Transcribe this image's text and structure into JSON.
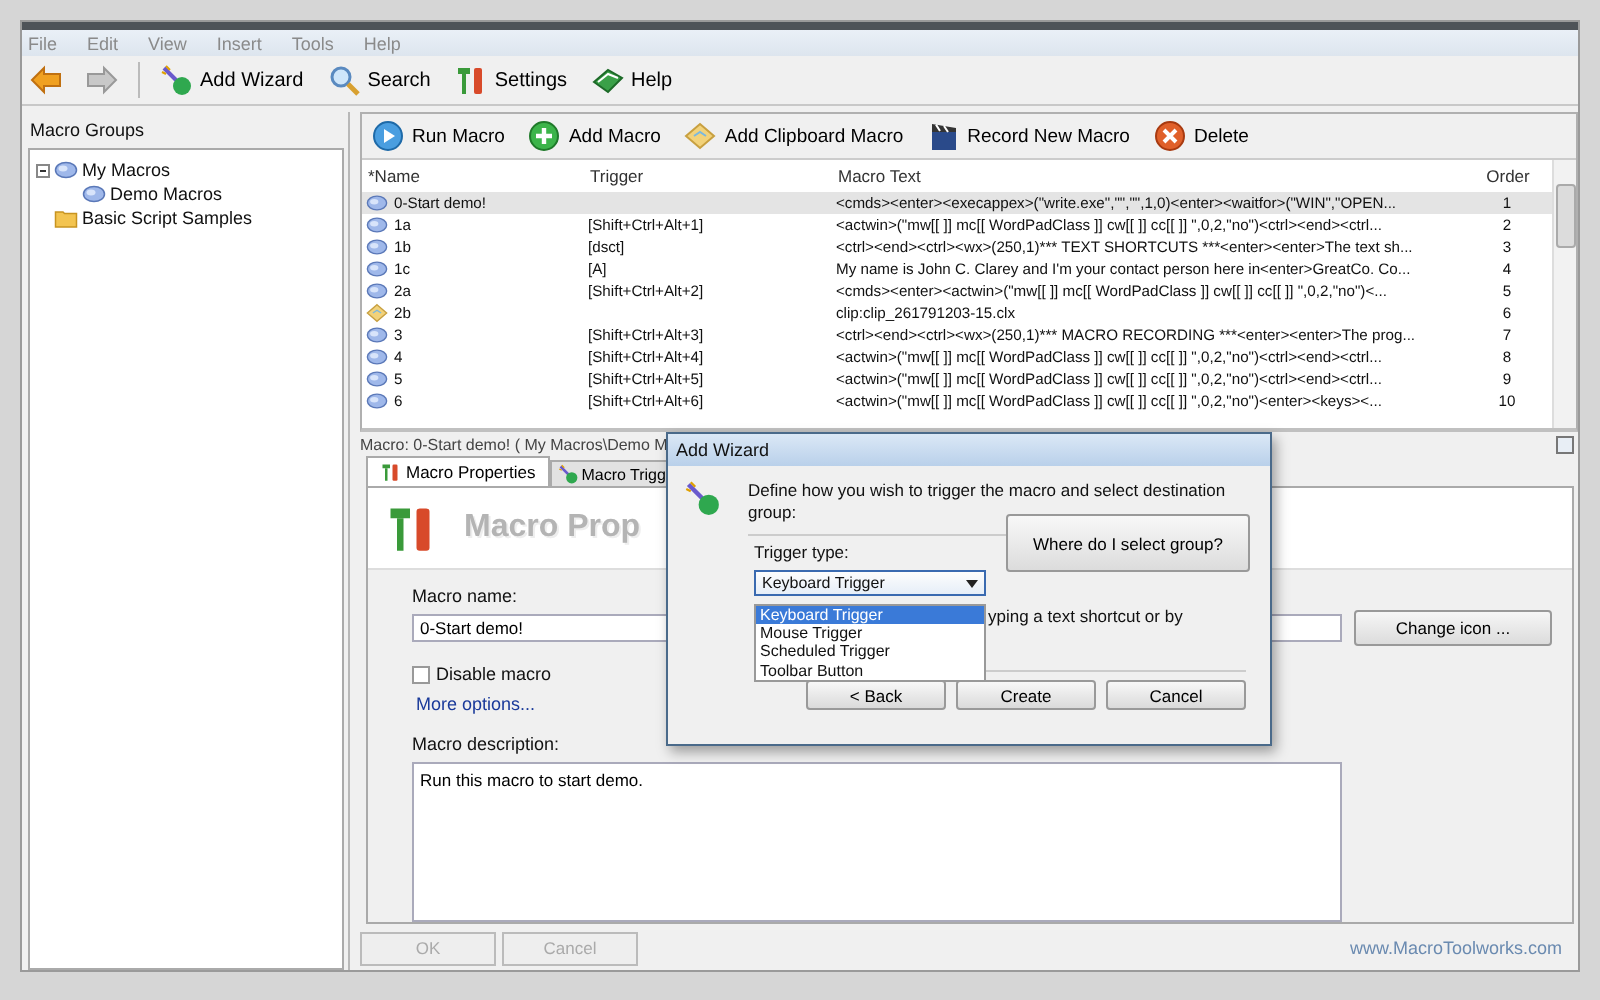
{
  "menu": [
    "File",
    "Edit",
    "View",
    "Insert",
    "Tools",
    "Help"
  ],
  "toolbar": [
    {
      "kind": "wizard",
      "label": "Add Wizard"
    },
    {
      "kind": "search",
      "label": "Search"
    },
    {
      "kind": "settings",
      "label": "Settings"
    },
    {
      "kind": "help",
      "label": "Help"
    }
  ],
  "groups": {
    "title": "Macro Groups",
    "tree": [
      {
        "label": "My Macros",
        "kind": "macro",
        "expanded": true,
        "children": [
          {
            "label": "Demo Macros",
            "kind": "macro"
          }
        ]
      },
      {
        "label": "Basic Script Samples",
        "kind": "folder"
      }
    ]
  },
  "macro_toolbar": [
    {
      "kind": "run",
      "label": "Run Macro"
    },
    {
      "kind": "add",
      "label": "Add Macro"
    },
    {
      "kind": "clip",
      "label": "Add Clipboard Macro"
    },
    {
      "kind": "record",
      "label": "Record New Macro"
    },
    {
      "kind": "delete",
      "label": "Delete"
    }
  ],
  "table": {
    "columns": [
      "*Name",
      "Trigger",
      "Macro Text",
      "Order"
    ],
    "rows": [
      {
        "kind": "macro",
        "selected": true,
        "name": "0-Start demo!",
        "trigger": "",
        "text": "<cmds><enter><execappex>(\"write.exe\",\"\",\"\",1,0)<enter><waitfor>(\"WIN\",\"OPEN...",
        "order": "1"
      },
      {
        "kind": "macro",
        "selected": false,
        "name": "1a",
        "trigger": "[Shift+Ctrl+Alt+1]",
        "text": "<actwin>(\"mw[[  ]] mc[[ WordPadClass ]] cw[[  ]] cc[[  ]] \",0,2,\"no\")<ctrl><end><ctrl...",
        "order": "2"
      },
      {
        "kind": "macro",
        "selected": false,
        "name": "1b",
        "trigger": "[dsct]",
        "text": "<ctrl><end><ctrl><wx>(250,1)*** TEXT SHORTCUTS ***<enter><enter>The text sh...",
        "order": "3"
      },
      {
        "kind": "macro",
        "selected": false,
        "name": "1c",
        "trigger": "[A]",
        "text": "My name is John C. Clarey and I'm your contact person here in<enter>GreatCo. Co...",
        "order": "4"
      },
      {
        "kind": "macro",
        "selected": false,
        "name": "2a",
        "trigger": "[Shift+Ctrl+Alt+2]",
        "text": "<cmds><enter><actwin>(\"mw[[  ]] mc[[ WordPadClass ]] cw[[  ]] cc[[  ]] \",0,2,\"no\")<...",
        "order": "5"
      },
      {
        "kind": "clip",
        "selected": false,
        "name": "2b",
        "trigger": "",
        "text": "clip:clip_261791203-15.clx",
        "order": "6"
      },
      {
        "kind": "macro",
        "selected": false,
        "name": "3",
        "trigger": "[Shift+Ctrl+Alt+3]",
        "text": "<ctrl><end><ctrl><wx>(250,1)*** MACRO RECORDING ***<enter><enter>The prog...",
        "order": "7"
      },
      {
        "kind": "macro",
        "selected": false,
        "name": "4",
        "trigger": "[Shift+Ctrl+Alt+4]",
        "text": "<actwin>(\"mw[[  ]] mc[[ WordPadClass ]] cw[[  ]] cc[[  ]] \",0,2,\"no\")<ctrl><end><ctrl...",
        "order": "8"
      },
      {
        "kind": "macro",
        "selected": false,
        "name": "5",
        "trigger": "[Shift+Ctrl+Alt+5]",
        "text": "<actwin>(\"mw[[  ]] mc[[ WordPadClass ]] cw[[  ]] cc[[  ]] \",0,2,\"no\")<ctrl><end><ctrl...",
        "order": "9"
      },
      {
        "kind": "macro",
        "selected": false,
        "name": "6",
        "trigger": "[Shift+Ctrl+Alt+6]",
        "text": "<actwin>(\"mw[[  ]] mc[[ WordPadClass ]] cw[[  ]] cc[[  ]] \",0,2,\"no\")<enter><keys><...",
        "order": "10"
      }
    ]
  },
  "editor": {
    "header": "Macro: 0-Start demo! ( My Macros\\Demo M",
    "tabs": [
      {
        "label": "Macro Properties",
        "selected": true
      },
      {
        "label": "Macro Trigg",
        "selected": false
      }
    ],
    "banner": "Macro Prop",
    "name_label": "Macro name:",
    "name_value": "0-Start demo!",
    "change_icon": "Change icon ...",
    "disable": {
      "label": "Disable macro",
      "checked": false
    },
    "more_options": "More options...",
    "description_label": "Macro description:",
    "description": "Run this macro to start demo.",
    "buttons": [
      {
        "label": "OK",
        "disabled": true
      },
      {
        "label": "Cancel",
        "disabled": true
      }
    ],
    "website": "www.MacroToolworks.com"
  },
  "dialog": {
    "title": "Add Wizard",
    "text": "Define how you wish to trigger the macro and select destination group:",
    "trigger_label": "Trigger type:",
    "trigger_value": "Keyboard Trigger",
    "options": [
      {
        "label": "Keyboard Trigger",
        "selected": true
      },
      {
        "label": "Mouse Trigger",
        "selected": false
      },
      {
        "label": "Scheduled Trigger",
        "selected": false
      },
      {
        "label": "Toolbar Button",
        "selected": false
      }
    ],
    "hint": "yping a text shortcut or by",
    "group_button": "Where do I select  group?",
    "buttons": [
      "< Back",
      "Create",
      "Cancel"
    ]
  }
}
